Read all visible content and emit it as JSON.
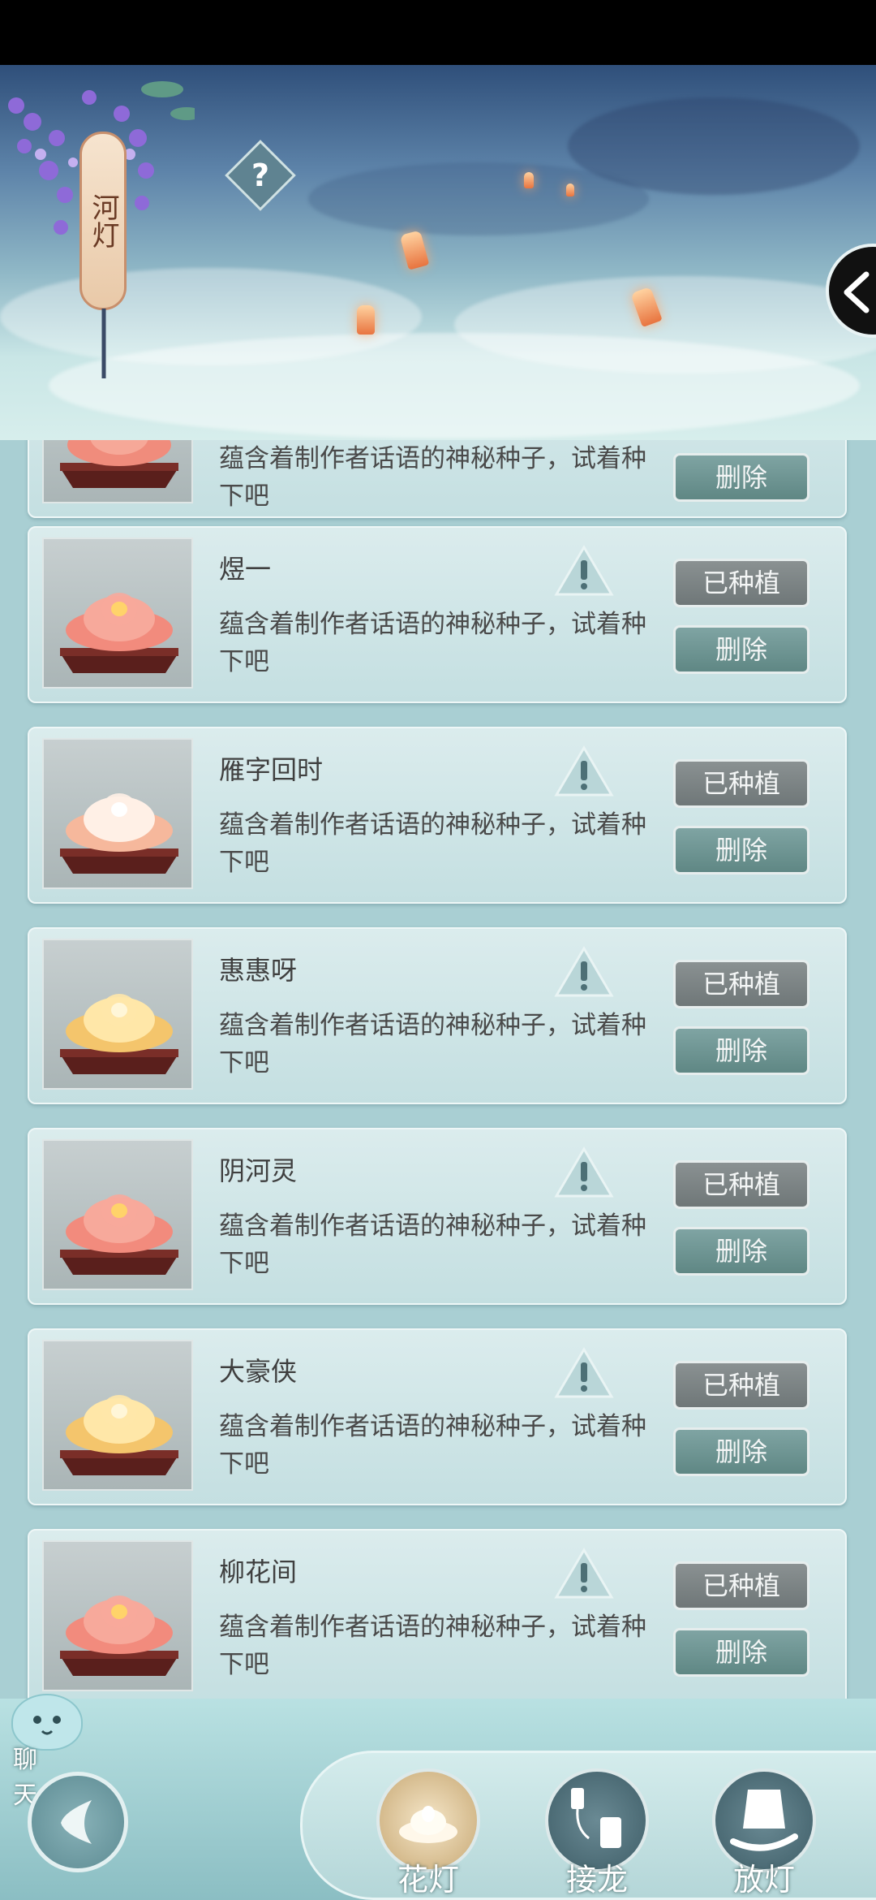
{
  "banner": {
    "title_tag": "河灯",
    "help_icon": "question-mark-icon",
    "back_icon": "chevron-left-icon"
  },
  "list": {
    "partial_card": {
      "description": "蕴含着制作者话语的神秘种子，试着种下吧",
      "delete_label": "删除"
    },
    "items": [
      {
        "name": "煜一",
        "description": "蕴含着制作者话语的神秘种子，试着种下吧",
        "planted_label": "已种植",
        "delete_label": "删除",
        "lotus": "pink"
      },
      {
        "name": "雁字回时",
        "description": "蕴含着制作者话语的神秘种子，试着种下吧",
        "planted_label": "已种植",
        "delete_label": "删除",
        "lotus": "white"
      },
      {
        "name": "惠惠呀",
        "description": "蕴含着制作者话语的神秘种子，试着种下吧",
        "planted_label": "已种植",
        "delete_label": "删除",
        "lotus": "gold"
      },
      {
        "name": "阴河灵",
        "description": "蕴含着制作者话语的神秘种子，试着种下吧",
        "planted_label": "已种植",
        "delete_label": "删除",
        "lotus": "pink"
      },
      {
        "name": "大豪侠",
        "description": "蕴含着制作者话语的神秘种子，试着种下吧",
        "planted_label": "已种植",
        "delete_label": "删除",
        "lotus": "gold"
      },
      {
        "name": "柳花间",
        "description": "蕴含着制作者话语的神秘种子，试着种下吧",
        "planted_label": "已种植",
        "delete_label": "删除",
        "lotus": "pink"
      }
    ]
  },
  "bottom_nav": {
    "chat_label": "聊天",
    "tabs": [
      {
        "label": "花灯",
        "icon": "lotus-lantern-icon",
        "active": true
      },
      {
        "label": "接龙",
        "icon": "relay-icon",
        "active": false
      },
      {
        "label": "放灯",
        "icon": "release-lantern-icon",
        "active": false
      }
    ]
  },
  "colors": {
    "planted_button": "#7d8586",
    "delete_button": "#6f9896",
    "card_bg": "#cfe5e7"
  }
}
